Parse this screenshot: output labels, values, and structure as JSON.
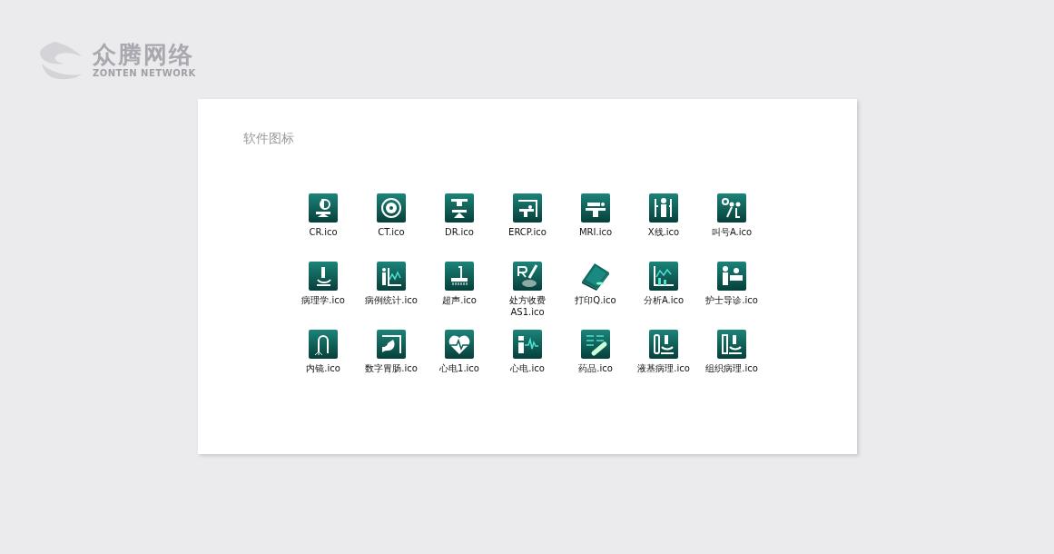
{
  "logo": {
    "name": "众腾网络",
    "tagline": "ZONTEN NETWORK"
  },
  "card": {
    "title": "软件图标",
    "icons": [
      {
        "label": "CR.ico"
      },
      {
        "label": "CT.ico"
      },
      {
        "label": "DR.ico"
      },
      {
        "label": "ERCP.ico"
      },
      {
        "label": "MRI.ico"
      },
      {
        "label": "X线.ico"
      },
      {
        "label": "叫号A.ico"
      },
      {
        "label": "病理学.ico"
      },
      {
        "label": "病例统计.ico"
      },
      {
        "label": "超声.ico"
      },
      {
        "label": "处方收费AS1.ico"
      },
      {
        "label": "打印Q.ico"
      },
      {
        "label": "分析A.ico"
      },
      {
        "label": "护士导诊.ico"
      },
      {
        "label": "内镜.ico"
      },
      {
        "label": "数字胃肠.ico"
      },
      {
        "label": "心电1.ico"
      },
      {
        "label": "心电.ico"
      },
      {
        "label": "药品.ico"
      },
      {
        "label": "液基病理.ico"
      },
      {
        "label": "组织病理.ico"
      }
    ]
  }
}
